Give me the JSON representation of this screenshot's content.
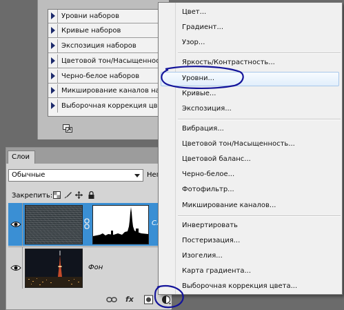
{
  "presets": {
    "items": [
      "Уровни наборов",
      "Кривые наборов",
      "Экспозиция наборов",
      "Цветовой тон/Насыщенность",
      "Черно-белое наборов",
      "Микширование каналов набо",
      "Выборочная коррекция цвета"
    ]
  },
  "layers_panel": {
    "tab_label": "Слои",
    "blend_mode": "Обычные",
    "opacity_label": "Неп",
    "lock_label": "Закрепить:",
    "layers": [
      {
        "name": "Сл",
        "selected": true
      },
      {
        "name": "Фон",
        "selected": false
      }
    ],
    "footer_fx": "fx"
  },
  "adjustment_menu": {
    "groups": [
      [
        "Цвет...",
        "Градиент...",
        "Узор..."
      ],
      [
        "Яркость/Контрастность...",
        "Уровни...",
        "Кривые...",
        "Экспозиция..."
      ],
      [
        "Вибрация...",
        "Цветовой тон/Насыщенность...",
        "Цветовой баланс...",
        "Черно-белое...",
        "Фотофильтр...",
        "Микширование каналов..."
      ],
      [
        "Инвертировать",
        "Постеризация...",
        "Изогелия...",
        "Карта градиента...",
        "Выборочная коррекция цвета..."
      ]
    ],
    "highlighted": "Уровни..."
  },
  "colors": {
    "selection_blue": "#3a8fd4",
    "annotation_blue": "#14149a",
    "menu_bg": "#f0f0f0"
  }
}
